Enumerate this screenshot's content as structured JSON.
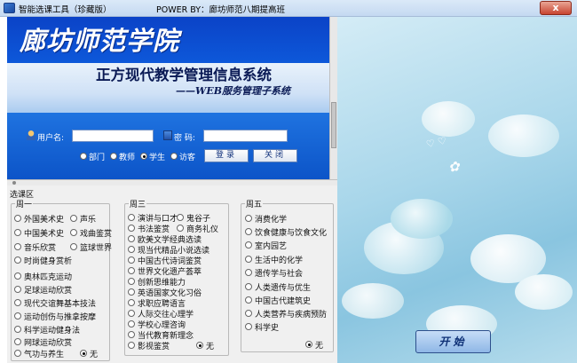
{
  "window": {
    "title": "智能选课工具（珍藏版）",
    "powered_by": "POWER BY：廊坊师范八期提高班",
    "close_label": "x"
  },
  "banner": {
    "school_name": "廊坊师范学院",
    "system_title": "正方现代教学管理信息系统",
    "system_subtitle": "——WEB服务管理子系统",
    "username_label": "用户名:",
    "username_value": "",
    "password_label": "密 码:",
    "password_value": "",
    "roles": [
      {
        "label": "部门",
        "selected": false
      },
      {
        "label": "教师",
        "selected": false
      },
      {
        "label": "学生",
        "selected": true
      },
      {
        "label": "访客",
        "selected": false
      }
    ],
    "login_button": "登录",
    "close_button": "关闭"
  },
  "course_area": {
    "label": "选课区",
    "groups": [
      {
        "title": "周一",
        "options": [
          {
            "label": "外国美术史",
            "selected": false
          },
          {
            "label": "声乐",
            "selected": false
          },
          {
            "label": "中国美术史",
            "selected": false
          },
          {
            "label": "戏曲鉴赏",
            "selected": false
          },
          {
            "label": "音乐欣赏",
            "selected": false
          },
          {
            "label": "篮球世界",
            "selected": false
          },
          {
            "label": "时尚健身赏析",
            "selected": false
          },
          {
            "label": "奥林匹克运动",
            "selected": false
          },
          {
            "label": "足球运动欣赏",
            "selected": false
          },
          {
            "label": "现代交谊舞基本技法",
            "selected": false
          },
          {
            "label": "运动创伤与推拿按摩",
            "selected": false
          },
          {
            "label": "科学运动健身法",
            "selected": false
          },
          {
            "label": "网球运动欣赏",
            "selected": false
          },
          {
            "label": "气功与养生",
            "selected": false
          },
          {
            "label": "无",
            "selected": true
          }
        ]
      },
      {
        "title": "周三",
        "options": [
          {
            "label": "演讲与口才",
            "selected": false
          },
          {
            "label": "鬼谷子",
            "selected": false
          },
          {
            "label": "书法鉴赏",
            "selected": false
          },
          {
            "label": "商务礼仪",
            "selected": false
          },
          {
            "label": "欧美文学经典选读",
            "selected": false
          },
          {
            "label": "现当代精品小说选读",
            "selected": false
          },
          {
            "label": "中国古代诗词鉴赏",
            "selected": false
          },
          {
            "label": "世界文化遗产荟萃",
            "selected": false
          },
          {
            "label": "创新思维能力",
            "selected": false
          },
          {
            "label": "英语国家文化习俗",
            "selected": false
          },
          {
            "label": "求职应聘语言",
            "selected": false
          },
          {
            "label": "人际交往心理学",
            "selected": false
          },
          {
            "label": "学校心理咨询",
            "selected": false
          },
          {
            "label": "当代教育新理念",
            "selected": false
          },
          {
            "label": "影视鉴赏",
            "selected": false
          },
          {
            "label": "无",
            "selected": true
          }
        ]
      },
      {
        "title": "周五",
        "options": [
          {
            "label": "消费化学",
            "selected": false
          },
          {
            "label": "饮食健康与饮食文化",
            "selected": false
          },
          {
            "label": "室内园艺",
            "selected": false
          },
          {
            "label": "生活中的化学",
            "selected": false
          },
          {
            "label": "遗传学与社会",
            "selected": false
          },
          {
            "label": "人类遗传与优生",
            "selected": false
          },
          {
            "label": "中国古代建筑史",
            "selected": false
          },
          {
            "label": "人类营养与疾病预防",
            "selected": false
          },
          {
            "label": "科学史",
            "selected": false
          },
          {
            "label": "无",
            "selected": true
          }
        ]
      }
    ]
  },
  "start_button": "开始",
  "colors": {
    "banner_blue": "#0e5fe0",
    "deco_teal": "#a8d6ea",
    "titlebar": "#c4d9f1"
  }
}
